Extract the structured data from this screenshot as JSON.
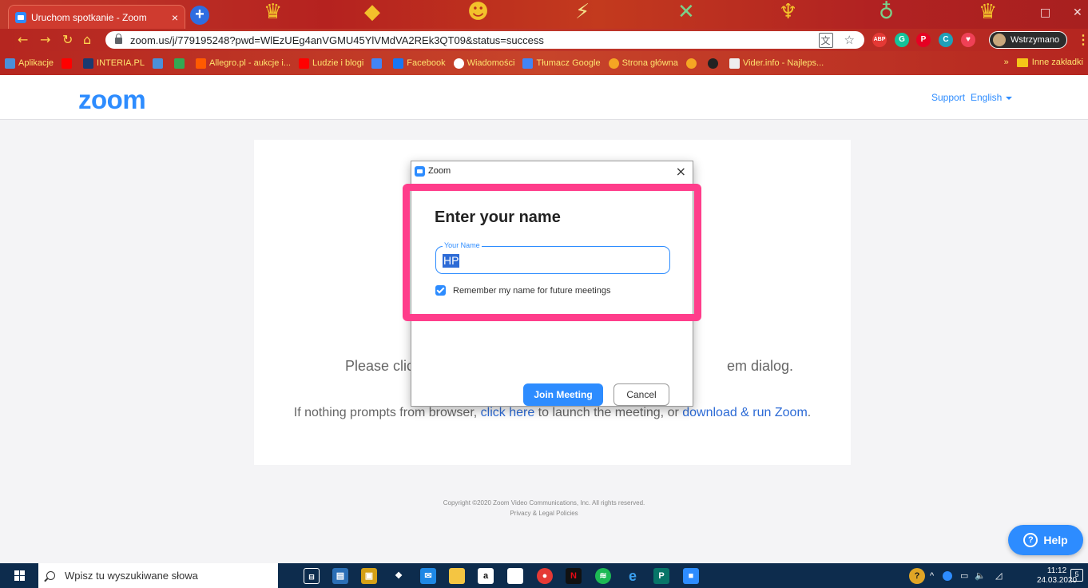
{
  "browser": {
    "tab_title": "Uruchom spotkanie - Zoom",
    "tab_close": "×",
    "new_tab": "+",
    "url": "zoom.us/j/779195248?pwd=WlEzUEg4anVGMU45YlVMdVA2REk3QT09&status=success",
    "profile_label": "Wstrzymano",
    "bookmarks": [
      "Aplikacje",
      "INTERIA.PL",
      "Allegro.pl - aukcje i...",
      "Ludzie i blogi",
      "Facebook",
      "Wiadomości",
      "Tłumacz Google",
      "Strona główna",
      "Vider.info - Najleps..."
    ],
    "bookmark_more": "»",
    "other_bookmarks": "Inne zakładki"
  },
  "zoom_header": {
    "logo": "zoom",
    "support_link": "Support",
    "language": "English"
  },
  "page": {
    "prompt_left": "Please clic",
    "prompt_right": "em dialog.",
    "hint_prefix": "If nothing prompts from browser, ",
    "hint_link1": "click here",
    "hint_middle": " to launch the meeting, or ",
    "hint_link2": "download & run Zoom",
    "hint_suffix": ".",
    "copyright": "Copyright ©2020 Zoom Video Communications, Inc. All rights reserved.",
    "privacy_link": "Privacy & Legal Policies",
    "help_label": "Help"
  },
  "dialog": {
    "window_title": "Zoom",
    "close": "×",
    "heading": "Enter your name",
    "name_label": "Your Name",
    "name_value": "HP",
    "remember_label": "Remember my name for future meetings",
    "remember_checked": true,
    "join_label": "Join Meeting",
    "cancel_label": "Cancel"
  },
  "taskbar": {
    "search_placeholder": "Wpisz tu wyszukiwane słowa",
    "time": "11:12",
    "date": "24.03.2020",
    "notifications": "5"
  },
  "colors": {
    "zoom_blue": "#2d8cff",
    "highlight_pink": "#ff3d8b",
    "taskbar": "#0d2c4d"
  }
}
